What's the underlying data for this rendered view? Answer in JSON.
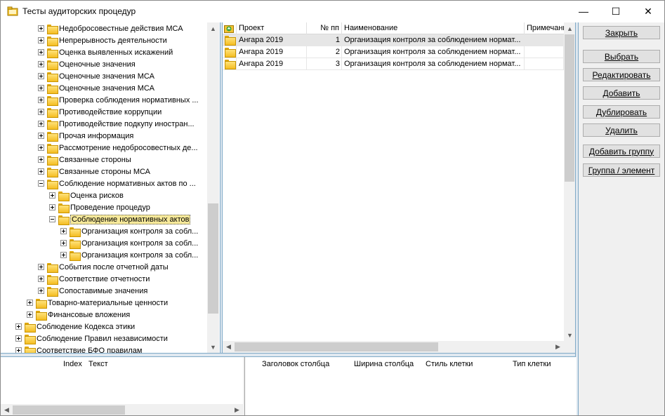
{
  "window": {
    "title": "Тесты аудиторских процедур",
    "minimize_glyph": "—",
    "maximize_glyph": "☐",
    "close_glyph": "✕"
  },
  "tree": {
    "items": [
      {
        "label": "Недобросовестные действия МСА",
        "level": 3,
        "expander": "plus"
      },
      {
        "label": "Непрерывность деятельности",
        "level": 3,
        "expander": "plus"
      },
      {
        "label": "Оценка выявленных искажений",
        "level": 3,
        "expander": "plus"
      },
      {
        "label": "Оценочные значения",
        "level": 3,
        "expander": "plus"
      },
      {
        "label": "Оценочные значения МСА",
        "level": 3,
        "expander": "plus"
      },
      {
        "label": "Оценочные значения МСА",
        "level": 3,
        "expander": "plus"
      },
      {
        "label": "Проверка соблюдения нормативных ...",
        "level": 3,
        "expander": "plus"
      },
      {
        "label": "Противодействие коррупции",
        "level": 3,
        "expander": "plus"
      },
      {
        "label": "Противодействие подкупу иностран...",
        "level": 3,
        "expander": "plus"
      },
      {
        "label": "Прочая информация",
        "level": 3,
        "expander": "plus"
      },
      {
        "label": "Рассмотрение недобросовестных де...",
        "level": 3,
        "expander": "plus"
      },
      {
        "label": "Связанные стороны",
        "level": 3,
        "expander": "plus"
      },
      {
        "label": "Связанные стороны МСА",
        "level": 3,
        "expander": "plus"
      },
      {
        "label": "Соблюдение нормативных актов по ...",
        "level": 3,
        "expander": "minus"
      },
      {
        "label": "Оценка рисков",
        "level": 4,
        "expander": "plus"
      },
      {
        "label": "Проведение процедур",
        "level": 4,
        "expander": "plus"
      },
      {
        "label": "Соблюдение нормативных актов",
        "level": 4,
        "expander": "minus",
        "selected": true
      },
      {
        "label": "Организация контроля за собл...",
        "level": 5,
        "expander": "plus"
      },
      {
        "label": "Организация контроля за собл...",
        "level": 5,
        "expander": "plus"
      },
      {
        "label": "Организация контроля за собл...",
        "level": 5,
        "expander": "plus"
      },
      {
        "label": "События после отчетной даты",
        "level": 3,
        "expander": "plus"
      },
      {
        "label": "Соответствие отчетности",
        "level": 3,
        "expander": "plus"
      },
      {
        "label": "Сопоставимые значения",
        "level": 3,
        "expander": "plus"
      },
      {
        "label": "Товарно-материальные ценности",
        "level": 2,
        "expander": "plus"
      },
      {
        "label": "Финансовые вложения",
        "level": 2,
        "expander": "plus"
      },
      {
        "label": "Соблюдение Кодекса этики",
        "level": 1,
        "expander": "plus"
      },
      {
        "label": "Соблюдение Правил независимости",
        "level": 1,
        "expander": "plus"
      },
      {
        "label": "Соответствие БФО правилам",
        "level": 1,
        "expander": "plus"
      }
    ]
  },
  "grid": {
    "columns": {
      "project": "Проект",
      "number": "№ пп",
      "name": "Наименование",
      "note": "Примечани"
    },
    "rows": [
      {
        "project": "Ангара 2019",
        "number": "1",
        "name": "Организация контроля за соблюдением нормат..."
      },
      {
        "project": "Ангара 2019",
        "number": "2",
        "name": "Организация контроля за соблюдением нормат..."
      },
      {
        "project": "Ангара 2019",
        "number": "3",
        "name": "Организация контроля за соблюдением нормат..."
      }
    ]
  },
  "buttons": {
    "close": "Закрыть",
    "select": "Выбрать",
    "edit": "Редактировать",
    "add": "Добавить",
    "duplicate": "Дублировать",
    "delete": "Удалить",
    "add_group": "Добавить группу",
    "group_element": "Группа / элемент"
  },
  "bottom_left": {
    "col_index": "Index",
    "col_text": "Текст"
  },
  "bottom_right": {
    "col_header": "Заголовок столбца",
    "col_width": "Ширина столбца",
    "col_style": "Стиль клетки",
    "col_type": "Тип клетки"
  }
}
